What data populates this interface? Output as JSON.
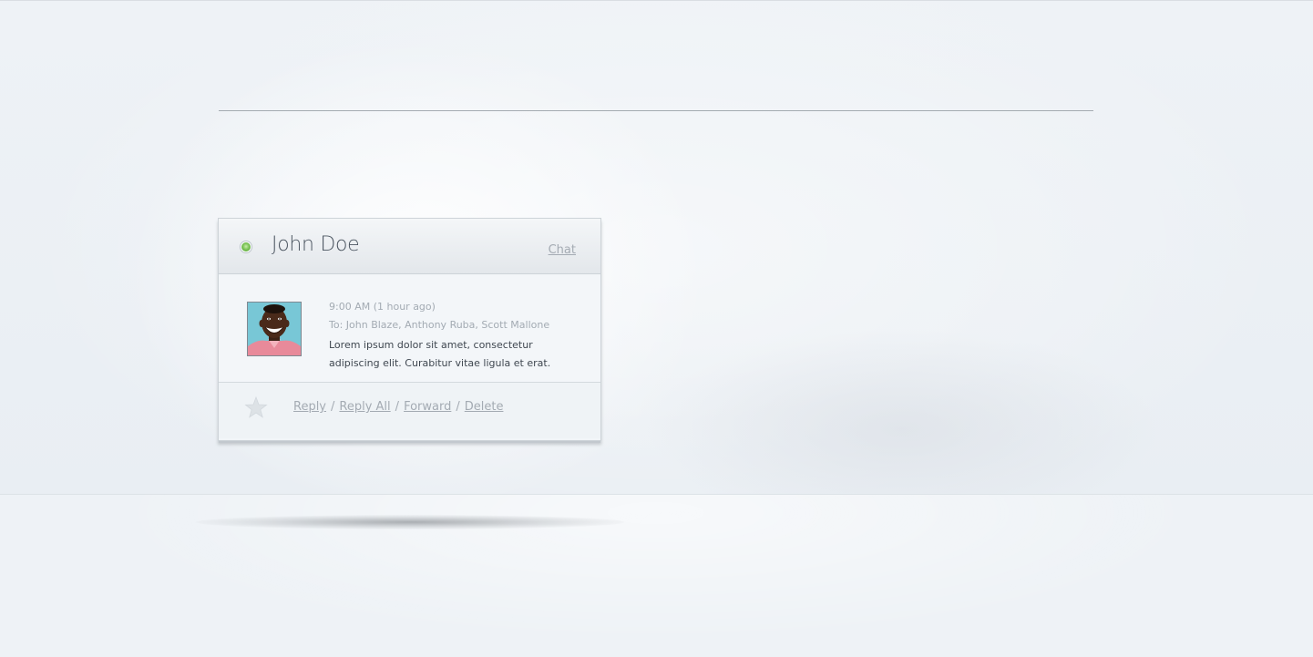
{
  "card": {
    "contact_name": "John Doe",
    "status": "online",
    "status_color": "#7cc457",
    "chat_label": "Chat",
    "message": {
      "time": "9:00 AM (1 hour ago)",
      "recipients": "To: John Blaze, Anthony Ruba, Scott Mallone",
      "body": "Lorem ipsum dolor sit amet, consectetur adipiscing elit. Curabitur vitae ligula et erat."
    },
    "actions": {
      "star_icon": "star-icon",
      "reply": "Reply",
      "reply_all": "Reply All",
      "forward": "Forward",
      "delete": "Delete",
      "separator": "/"
    }
  },
  "colors": {
    "background": "#eef2f6",
    "link": "#a4abb3",
    "text": "#3f4750",
    "name": "#4c5661"
  }
}
